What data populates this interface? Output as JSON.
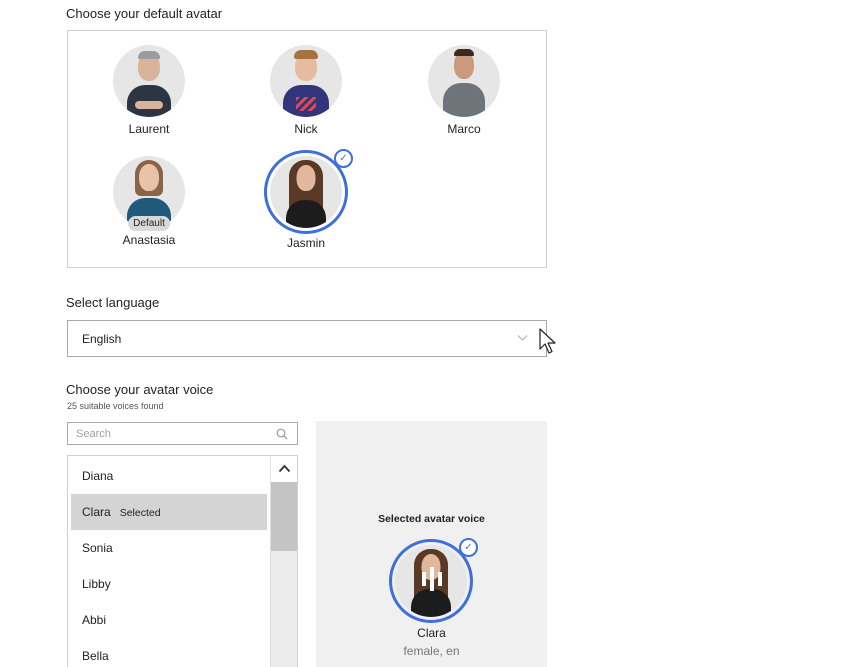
{
  "avatars_section": {
    "title": "Choose your default avatar",
    "avatars": [
      {
        "name": "Laurent",
        "hair": "#9c9c9c",
        "skin": "#d9b49a",
        "clothes": "#2e3542"
      },
      {
        "name": "Nick",
        "hair": "#a5733d",
        "skin": "#e5bca0",
        "clothes": "#33357a"
      },
      {
        "name": "Marco",
        "hair": "#3a2a20",
        "skin": "#c99a7d",
        "clothes": "#6e747a"
      },
      {
        "name": "Anastasia",
        "hair": "#8a6448",
        "skin": "#e8c3a8",
        "clothes": "#1f5a7a",
        "badge": "Default"
      },
      {
        "name": "Jasmin",
        "hair": "#5a3a26",
        "skin": "#e2b89c",
        "clothes": "#1c1c1c",
        "selected": true
      }
    ],
    "check_symbol": "✓"
  },
  "language_section": {
    "title": "Select language",
    "selected": "English",
    "chevron_icon": "chevron-down-icon"
  },
  "voice_section": {
    "title": "Choose your avatar voice",
    "subtitle": "25 suitable voices found",
    "search_placeholder": "Search",
    "search_icon": "search-icon",
    "voices": [
      {
        "name": "Diana"
      },
      {
        "name": "Clara",
        "tag": "Selected",
        "selected": true
      },
      {
        "name": "Sonia"
      },
      {
        "name": "Libby"
      },
      {
        "name": "Abbi"
      },
      {
        "name": "Bella"
      }
    ],
    "scroll_up_symbol": "^"
  },
  "selected_voice_panel": {
    "heading": "Selected avatar voice",
    "name": "Clara",
    "meta": "female, en",
    "check_symbol": "✓",
    "accent_color": "#3f6fd8"
  }
}
